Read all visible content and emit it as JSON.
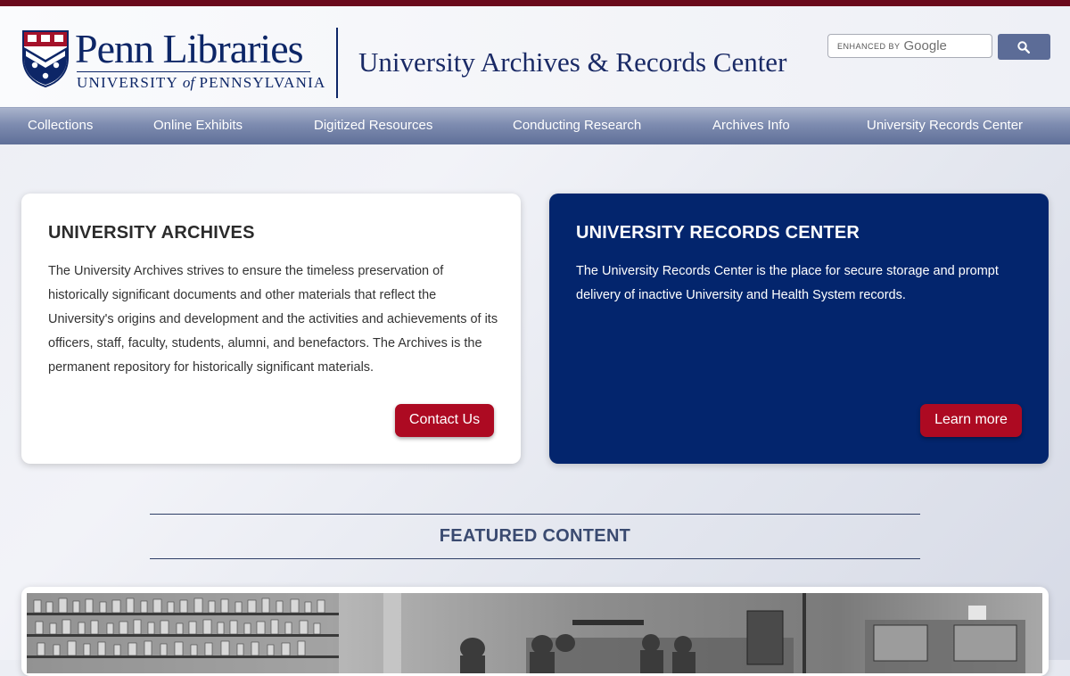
{
  "header": {
    "logo": {
      "name": "Penn Libraries",
      "subtitle_part1": "University",
      "subtitle_of": "of",
      "subtitle_part2": "Pennsylvania"
    },
    "site_title": "University Archives & Records Center",
    "search": {
      "watermark_enhanced": "ENHANCED BY",
      "watermark_google": "Google",
      "button_icon": "search-icon"
    }
  },
  "nav": {
    "items": [
      {
        "label": "Collections"
      },
      {
        "label": "Online Exhibits"
      },
      {
        "label": "Digitized Resources"
      },
      {
        "label": "Conducting Research"
      },
      {
        "label": "Archives Info"
      },
      {
        "label": "University Records Center"
      }
    ]
  },
  "cards": {
    "archives": {
      "title": "UNIVERSITY ARCHIVES",
      "text": "The University Archives strives to ensure the timeless preservation of historically significant documents and other materials that reflect the University's origins and development and the activities and achievements of its officers, staff, faculty, students, alumni, and benefactors. The Archives is the permanent repository for historically significant materials.",
      "button": "Contact Us"
    },
    "records": {
      "title": "UNIVERSITY RECORDS CENTER",
      "text": "The University Records Center is the place for secure storage and prompt delivery of inactive University and Health System records.",
      "button": "Learn more"
    }
  },
  "featured": {
    "title": "FEATURED CONTENT"
  },
  "colors": {
    "top_bar": "#6a0a1c",
    "brand_navy": "#03256d",
    "button_red": "#ad0a22",
    "nav_gradient_bottom": "#5f6f98",
    "search_button": "#5c6c97"
  }
}
